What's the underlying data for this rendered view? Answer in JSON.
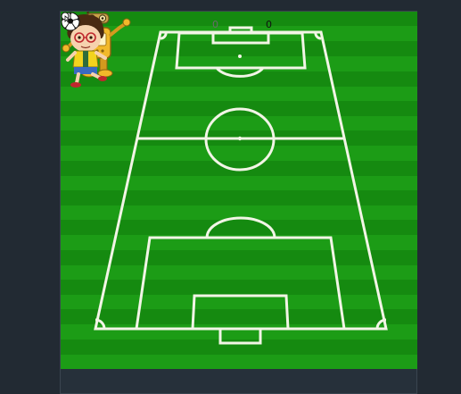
{
  "game": {
    "score_left": "0",
    "score_right": "0"
  },
  "colors": {
    "grass_dark": "#158a10",
    "grass_light": "#1c9c16",
    "line": "#f2f5e6",
    "page_background": "#222a33",
    "score_left": "#6a6a6a",
    "score_right": "#101010"
  },
  "icons": {
    "player_left": "robot-icon",
    "player_right": "cartoon-boy-icon",
    "ball": "soccer-ball-icon",
    "pointer": "mouse-pointer-icon"
  }
}
